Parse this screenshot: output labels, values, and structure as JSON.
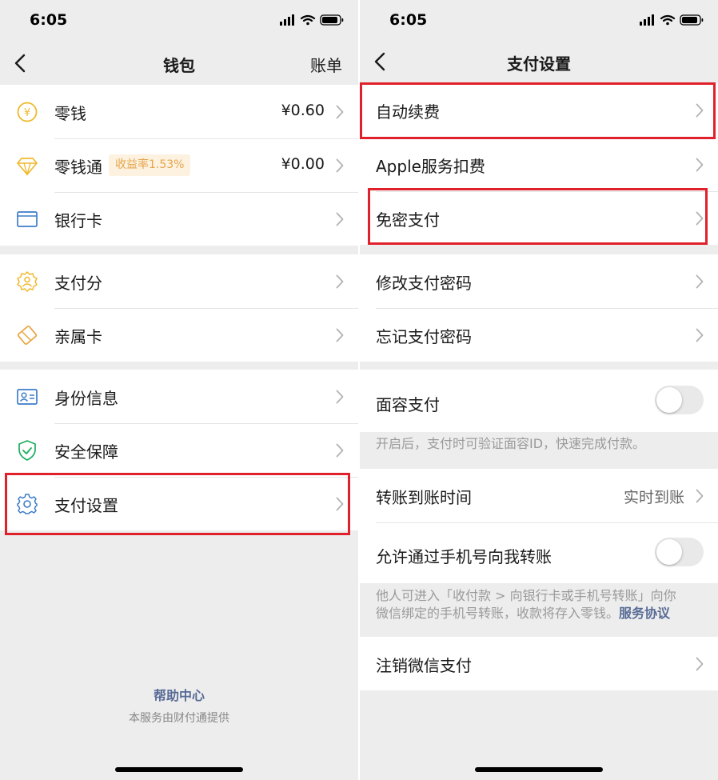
{
  "left": {
    "time": "6:05",
    "nav": {
      "title": "钱包",
      "right_link": "账单"
    },
    "group1": [
      {
        "label": "零钱",
        "value": "¥0.60",
        "icon": "yuan-coin-icon"
      },
      {
        "label": "零钱通",
        "badge": "收益率1.53%",
        "value": "¥0.00",
        "icon": "diamond-icon"
      },
      {
        "label": "银行卡",
        "icon": "bank-card-icon"
      }
    ],
    "group2": [
      {
        "label": "支付分",
        "icon": "pay-score-icon"
      },
      {
        "label": "亲属卡",
        "icon": "family-card-icon"
      }
    ],
    "group3": [
      {
        "label": "身份信息",
        "icon": "id-card-icon"
      },
      {
        "label": "安全保障",
        "icon": "shield-check-icon"
      },
      {
        "label": "支付设置",
        "icon": "gear-icon"
      }
    ],
    "footer": {
      "help": "帮助中心",
      "note": "本服务由财付通提供"
    }
  },
  "right": {
    "time": "6:05",
    "nav": {
      "title": "支付设置"
    },
    "group1": [
      {
        "label": "自动续费"
      },
      {
        "label": "Apple服务扣费"
      },
      {
        "label": "免密支付"
      }
    ],
    "group2": [
      {
        "label": "修改支付密码"
      },
      {
        "label": "忘记支付密码"
      }
    ],
    "faceid": {
      "label": "面容支付",
      "enabled": false,
      "note": "开启后，支付时可验证面容ID，快速完成付款。"
    },
    "transfer_time": {
      "label": "转账到账时间",
      "value": "实时到账"
    },
    "phone_transfer": {
      "label": "允许通过手机号向我转账",
      "enabled": false,
      "note_line1": "他人可进入「收付款 > 向银行卡或手机号转账」向你",
      "note_line2": "微信绑定的手机号转账，收款将存入零钱。",
      "note_link": "服务协议"
    },
    "cancel": {
      "label": "注销微信支付"
    }
  },
  "colors": {
    "highlight": "#e0212c",
    "link": "#576b95",
    "badge_text": "#e4a64b",
    "icon_yellow": "#f0b92b",
    "icon_blue": "#3d7cc9",
    "icon_green": "#1aad5d"
  }
}
